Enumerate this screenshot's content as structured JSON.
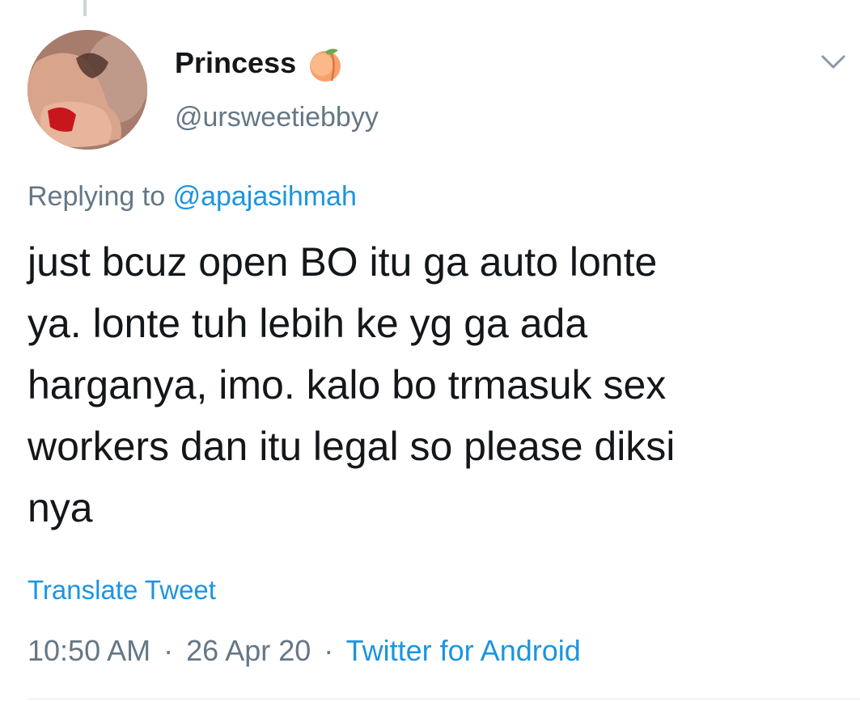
{
  "author": {
    "display_name": "Princess",
    "handle": "@ursweetiebbyy",
    "name_emoji": "peach-emoji"
  },
  "reply": {
    "prefix": "Replying to",
    "to_handle": "@apajasihmah"
  },
  "tweet": {
    "lines": [
      "just bcuz open BO itu ga auto lonte",
      "ya. lonte tuh lebih ke yg ga ada",
      "harganya, imo. kalo bo trmasuk sex",
      "workers dan itu legal so please diksi",
      "nya"
    ]
  },
  "translate_label": "Translate Tweet",
  "meta": {
    "time": "10:50 AM",
    "separator": "·",
    "date": "26 Apr 20",
    "source": "Twitter for Android"
  },
  "icons": {
    "menu": "chevron-down-icon"
  },
  "colors": {
    "text": "#14171a",
    "secondary": "#657786",
    "link": "#1b95e0",
    "divider": "#e6ecf0"
  }
}
